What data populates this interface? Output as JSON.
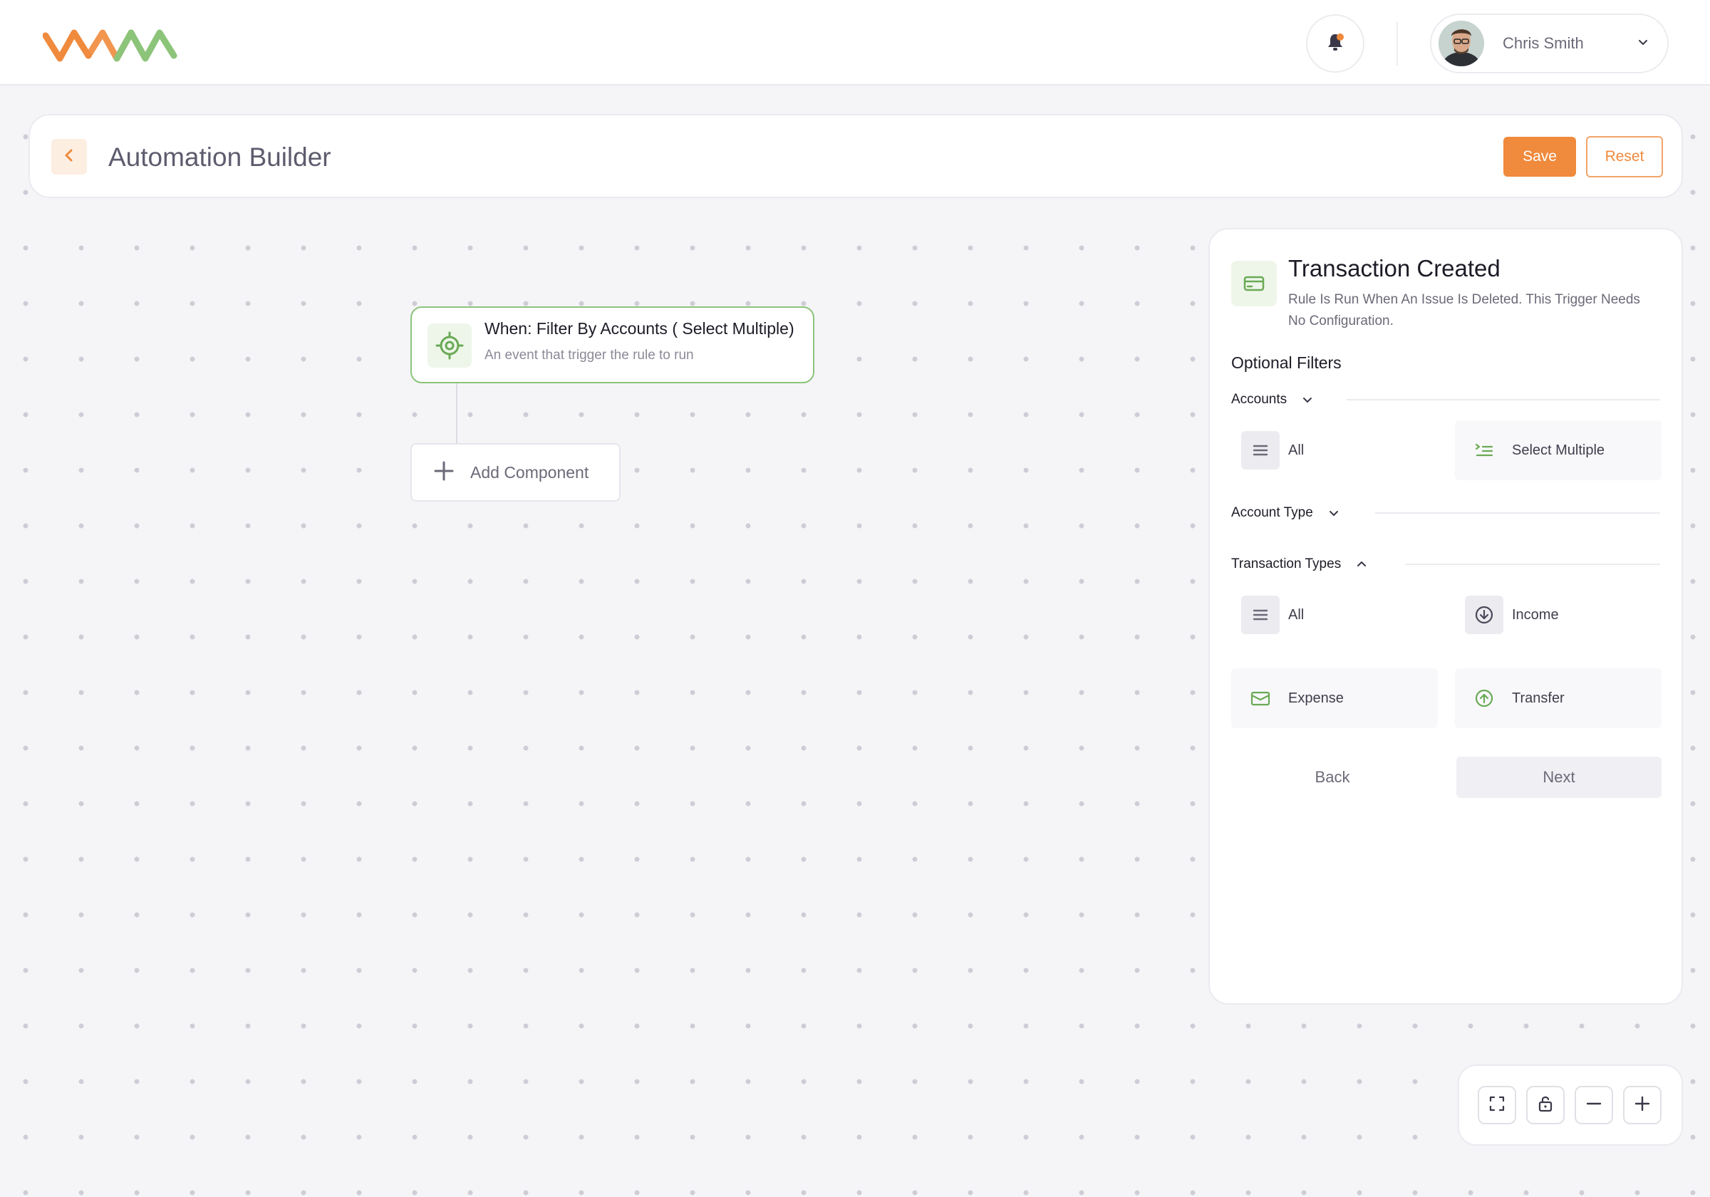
{
  "header": {
    "title": "Automation Builder",
    "save_label": "Save",
    "reset_label": "Reset"
  },
  "user": {
    "name": "Chris Smith"
  },
  "canvas": {
    "trigger": {
      "title": "When: Filter By Accounts ( Select Multiple)",
      "subtitle": "An event that trigger the rule to run"
    },
    "add_component_label": "Add Component"
  },
  "panel": {
    "title": "Transaction Created",
    "description": "Rule Is Run When An Issue Is Deleted. This Trigger Needs No Configuration.",
    "optional_filters_label": "Optional Filters",
    "sections": {
      "accounts": {
        "label": "Accounts",
        "options": [
          "All",
          "Select Multiple"
        ]
      },
      "account_type": {
        "label": "Account Type"
      },
      "transaction_types": {
        "label": "Transaction Types",
        "options": [
          "All",
          "Income",
          "Expense",
          "Transfer"
        ]
      }
    },
    "back_label": "Back",
    "next_label": "Next"
  },
  "colors": {
    "accent_orange": "#f08a3c",
    "accent_green": "#6aaa55",
    "brand_logo_orange": "#f08a3c",
    "brand_logo_green": "#8cc47a"
  },
  "icons": [
    "logo",
    "bell-icon",
    "chevron-down-icon",
    "chevron-left-icon",
    "target-icon",
    "plus-icon",
    "card-icon",
    "list-icon",
    "multi-select-icon",
    "arrow-down-circle-icon",
    "arrow-up-circle-icon",
    "wallet-icon",
    "chevron-up-icon",
    "fullscreen-icon",
    "unlock-icon",
    "minus-icon"
  ]
}
